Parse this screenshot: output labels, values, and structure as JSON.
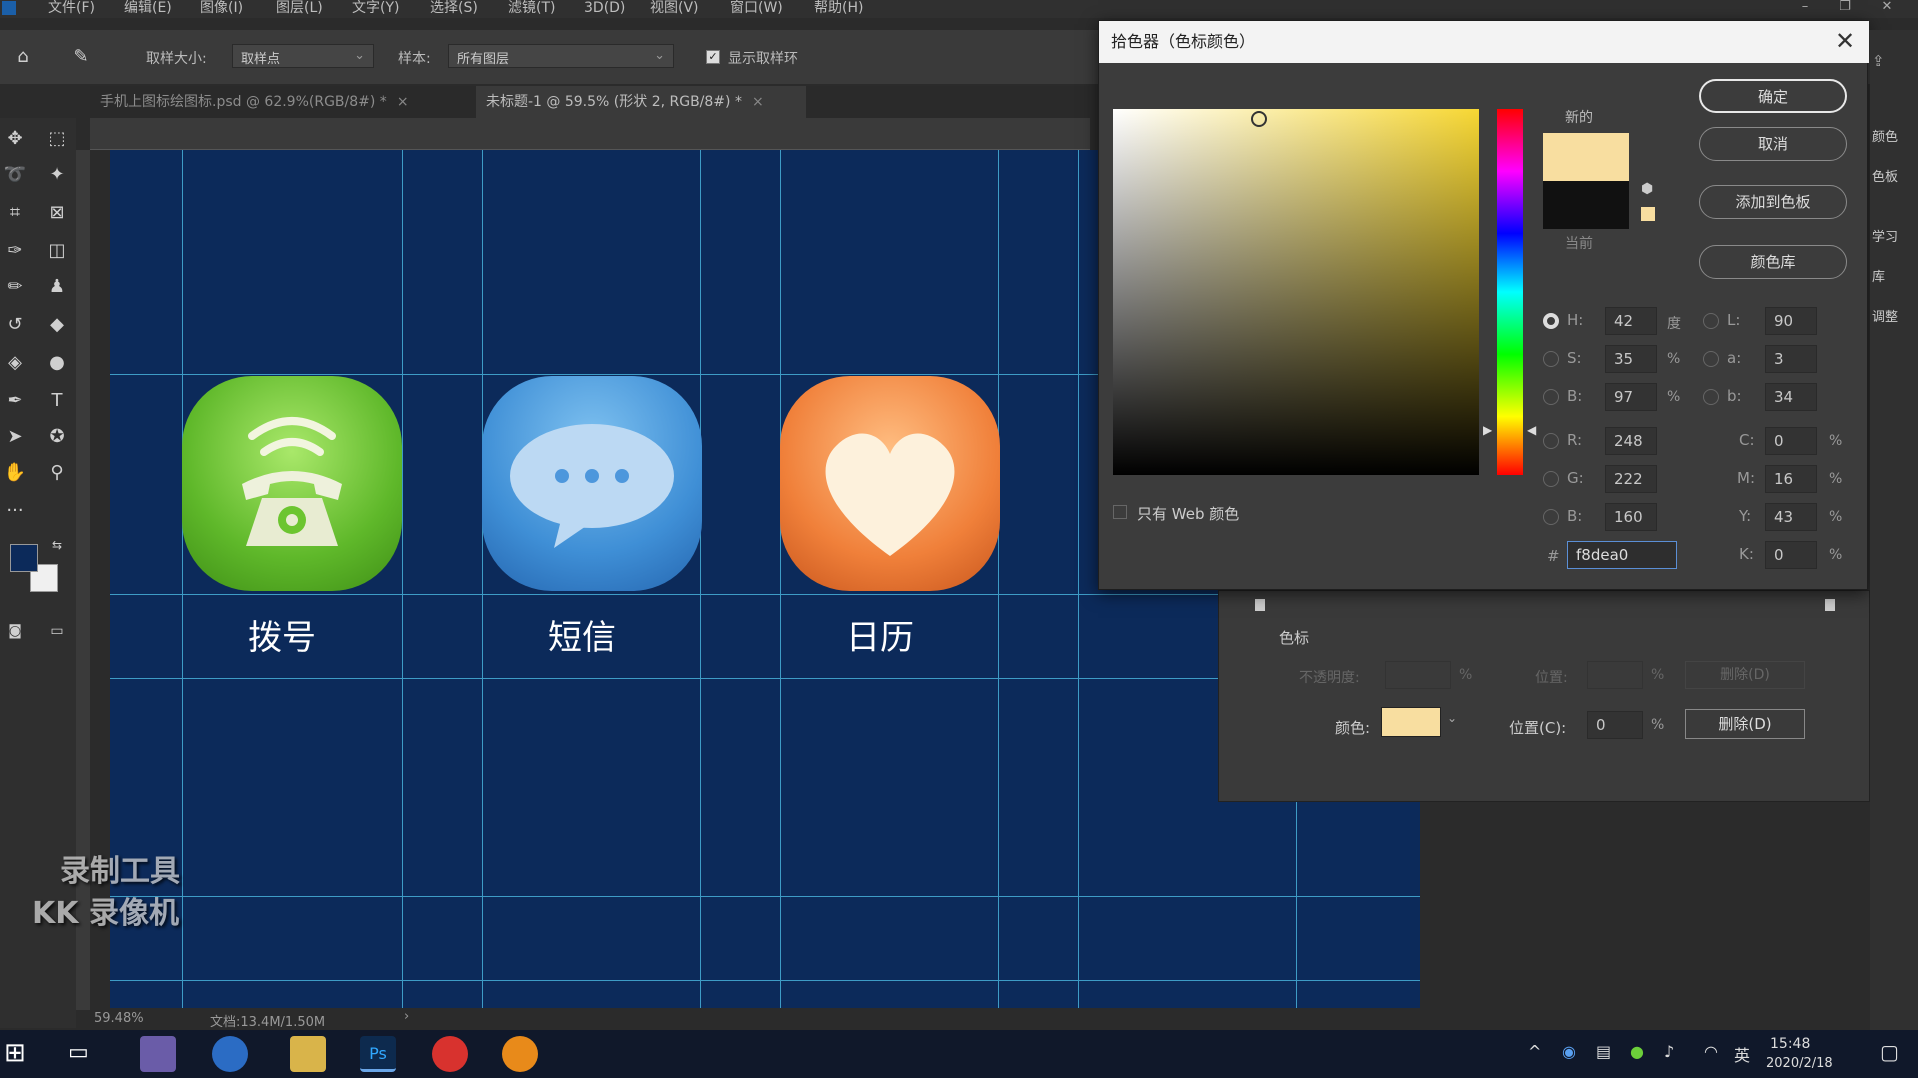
{
  "menu": [
    "文件(F)",
    "编辑(E)",
    "图像(I)",
    "图层(L)",
    "文字(Y)",
    "选择(S)",
    "滤镜(T)",
    "3D(D)",
    "视图(V)",
    "窗口(W)",
    "帮助(H)"
  ],
  "options_bar": {
    "sample_size_label": "取样大小:",
    "sample_size_value": "取样点",
    "sample_label": "样本:",
    "sample_value": "所有图层",
    "show_ring_label": "显示取样环"
  },
  "tabs": [
    {
      "title": "手机上图标绘图标.psd @ 62.9%(RGB/8#) *",
      "active": false
    },
    {
      "title": "未标题-1 @ 59.5% (形状 2, RGB/8#) *",
      "active": true
    }
  ],
  "canvas": {
    "background": "#0c2a5a",
    "icons": [
      {
        "label": "拨号",
        "icon": "phone-icon",
        "color": "#6cc530"
      },
      {
        "label": "短信",
        "icon": "message-bubble-icon",
        "color": "#3f8fd6"
      },
      {
        "label": "日历",
        "icon": "heart-icon",
        "color": "#f0803a"
      }
    ]
  },
  "color_picker": {
    "title": "拾色器（色标颜色）",
    "new_label": "新的",
    "current_label": "当前",
    "new_color": "#f8dea0",
    "current_color": "#111111",
    "buttons": {
      "ok": "确定",
      "cancel": "取消",
      "add_swatch": "添加到色板",
      "libraries": "颜色库"
    },
    "only_web_colors": "只有 Web 颜色",
    "hsb": {
      "h_label": "H:",
      "h": "42",
      "h_unit": "度",
      "s_label": "S:",
      "s": "35",
      "s_unit": "%",
      "b_label": "B:",
      "b": "97",
      "b_unit": "%"
    },
    "rgb": {
      "r_label": "R:",
      "r": "248",
      "g_label": "G:",
      "g": "222",
      "b_label": "B:",
      "b": "160"
    },
    "lab": {
      "l_label": "L:",
      "l": "90",
      "a_label": "a:",
      "a": "3",
      "b_label": "b:",
      "b": "34"
    },
    "cmyk": {
      "c_label": "C:",
      "c": "0",
      "m_label": "M:",
      "m": "16",
      "y_label": "Y:",
      "y": "43",
      "k_label": "K:",
      "k": "0",
      "unit": "%"
    },
    "hex_label": "#",
    "hex": "f8dea0"
  },
  "gradient_editor": {
    "section_label": "色标",
    "opacity_label": "不透明度:",
    "location_label": "位置:",
    "delete_label": "删除(D)",
    "color_label": "颜色:",
    "color_value": "#f8dea0",
    "position_label": "位置(C):",
    "position_value": "0",
    "unit": "%",
    "delete_button": "删除(D)"
  },
  "right_dock": [
    "颜色",
    "色板",
    "学习",
    "库",
    "调整"
  ],
  "status": {
    "zoom": "59.48%",
    "doc": "文档:13.4M/1.50M"
  },
  "watermark": {
    "line1": "录制工具",
    "line2": "KK 录像机"
  },
  "taskbar": {
    "time": "15:48",
    "date": "2020/2/18",
    "ime": "英"
  }
}
